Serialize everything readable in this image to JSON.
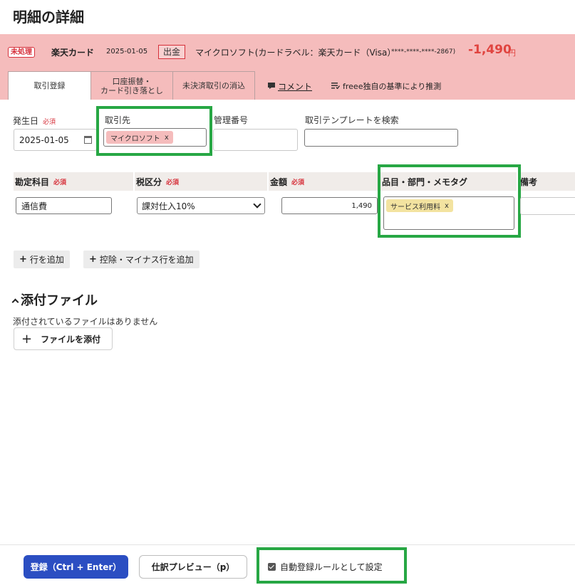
{
  "page": {
    "title": "明細の詳細"
  },
  "summary": {
    "status_badge": "未処理",
    "card_name": "楽天カード",
    "date": "2025-01-05",
    "type": "出金",
    "description": "マイクロソフト(カードラベル：楽天カード（Visa）",
    "card_number": "****-****-****-2867)",
    "amount": "-1,490",
    "currency": "円"
  },
  "tabs": [
    {
      "label": "取引登録",
      "active": true
    },
    {
      "label_line1": "口座振替・",
      "label_line2": "カード引き落とし",
      "active": false
    },
    {
      "label": "未決済取引の消込",
      "active": false
    }
  ],
  "tab_links": {
    "comment": "コメント",
    "estimate": "freee独自の基準により推測"
  },
  "form": {
    "required": "必須",
    "date": {
      "label": "発生日",
      "value": "2025-01-05"
    },
    "partner": {
      "label": "取引先",
      "tag": "マイクロソフト"
    },
    "management_no": {
      "label": "管理番号",
      "value": ""
    },
    "template_search": {
      "label": "取引テンプレートを検索",
      "value": ""
    }
  },
  "table": {
    "headers": {
      "account": "勘定科目",
      "tax": "税区分",
      "amount": "金額",
      "items": "品目・部門・メモタグ",
      "note": "備考"
    },
    "row": {
      "account": "通信費",
      "tax": "課対仕入10%",
      "amount": "1,490",
      "item_tag": "サービス利用料",
      "note": ""
    }
  },
  "actions": {
    "add_row": "行を追加",
    "add_deduction_row": "控除・マイナス行を追加"
  },
  "attachments": {
    "title": "添付ファイル",
    "empty_text": "添付されているファイルはありません",
    "attach_button": "ファイルを添付"
  },
  "footer": {
    "register": "登録（Ctrl + Enter）",
    "preview": "仕訳プレビュー（p）",
    "auto_rule": "自動登録ルールとして設定"
  },
  "colors": {
    "band": "#f5bcbc",
    "accent_red": "#e0443f",
    "primary": "#2b4ec2",
    "highlight": "#27a744"
  }
}
